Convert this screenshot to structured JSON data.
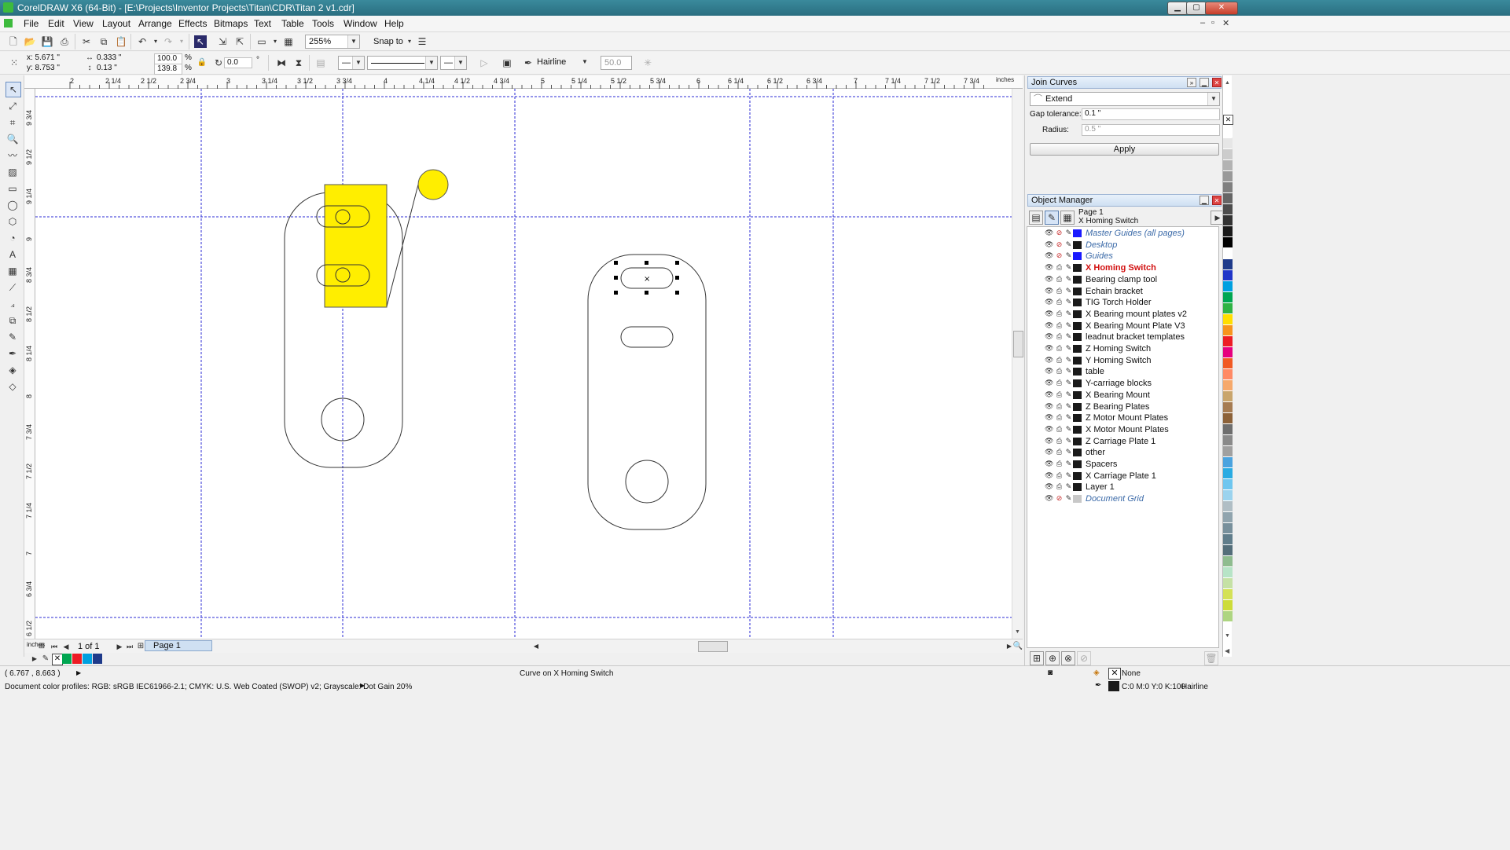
{
  "titlebar": {
    "title": "CorelDRAW X6 (64-Bit) - [E:\\Projects\\Inventor Projects\\Titan\\CDR\\Titan 2 v1.cdr]",
    "minimize": "▁",
    "maximize": "▢",
    "close": "✕"
  },
  "menu": [
    "File",
    "Edit",
    "View",
    "Layout",
    "Arrange",
    "Effects",
    "Bitmaps",
    "Text",
    "Table",
    "Tools",
    "Window",
    "Help"
  ],
  "standard_toolbar": {
    "zoom_level": "255%",
    "snap_to": "Snap to"
  },
  "property_bar": {
    "x": "x: 5.671 \"",
    "y": "y: 8.753 \"",
    "width": "0.333 \"",
    "height": "0.13 \"",
    "scale_x": "100.0",
    "scale_y": "139.8",
    "pct": "%",
    "rotation": "0.0",
    "degree": "°",
    "outline_width": "Hairline",
    "miter": "50.0"
  },
  "ruler": {
    "h_ticks": [
      "2",
      "2 1/4",
      "2 1/2",
      "2 3/4",
      "3",
      "3 1/4",
      "3 1/2",
      "3 3/4",
      "4",
      "4 1/4",
      "4 1/2",
      "4 3/4",
      "5",
      "5 1/4",
      "5 1/2",
      "5 3/4",
      "6",
      "6 1/4",
      "6 1/2",
      "6 3/4",
      "7",
      "7 1/4",
      "7 1/2",
      "7 3/4"
    ],
    "h_units": "inches",
    "v_ticks": [
      "9 3/4",
      "9 1/2",
      "9 1/4",
      "9",
      "8 3/4",
      "8 1/2",
      "8 1/4",
      "8",
      "7 3/4",
      "7 1/2",
      "7 1/4",
      "7",
      "6 3/4",
      "6 1/2"
    ],
    "v_units": "inches"
  },
  "page_nav": {
    "count": "1 of 1",
    "tab": "Page 1"
  },
  "join_curves": {
    "title": "Join Curves",
    "mode": "Extend",
    "gap_label": "Gap tolerance:",
    "gap_value": "0.1 \"",
    "radius_label": "Radius:",
    "radius_value": "0.5 \"",
    "apply": "Apply"
  },
  "object_manager": {
    "title": "Object Manager",
    "page": "Page 1",
    "current_layer": "X Homing Switch",
    "layers": [
      {
        "name": "Master Guides (all pages)",
        "kind": "master",
        "color": "#1a1aff"
      },
      {
        "name": "Desktop",
        "kind": "master",
        "color": "#1a1a1a"
      },
      {
        "name": "Guides",
        "kind": "master",
        "color": "#1a1aff"
      },
      {
        "name": "X Homing Switch",
        "kind": "active",
        "color": "#1a1a1a"
      },
      {
        "name": "Bearing clamp tool",
        "kind": "normal",
        "color": "#1a1a1a"
      },
      {
        "name": "Echain bracket",
        "kind": "normal",
        "color": "#1a1a1a"
      },
      {
        "name": "TIG Torch Holder",
        "kind": "normal",
        "color": "#1a1a1a"
      },
      {
        "name": "X Bearing mount plates v2",
        "kind": "normal",
        "color": "#1a1a1a"
      },
      {
        "name": "X Bearing Mount Plate V3",
        "kind": "normal",
        "color": "#1a1a1a"
      },
      {
        "name": "leadnut bracket templates",
        "kind": "normal",
        "color": "#1a1a1a"
      },
      {
        "name": "Z Homing Switch",
        "kind": "normal",
        "color": "#1a1a1a"
      },
      {
        "name": "Y Homing Switch",
        "kind": "normal",
        "color": "#1a1a1a"
      },
      {
        "name": "table",
        "kind": "normal",
        "color": "#1a1a1a"
      },
      {
        "name": "Y-carriage blocks",
        "kind": "normal",
        "color": "#1a1a1a"
      },
      {
        "name": "X Bearing Mount",
        "kind": "normal",
        "color": "#1a1a1a"
      },
      {
        "name": "Z Bearing Plates",
        "kind": "normal",
        "color": "#1a1a1a"
      },
      {
        "name": "Z Motor Mount Plates",
        "kind": "normal",
        "color": "#1a1a1a"
      },
      {
        "name": "X Motor Mount Plates",
        "kind": "normal",
        "color": "#1a1a1a"
      },
      {
        "name": "Z Carriage Plate 1",
        "kind": "normal",
        "color": "#1a1a1a"
      },
      {
        "name": "other",
        "kind": "normal",
        "color": "#1a1a1a"
      },
      {
        "name": "Spacers",
        "kind": "normal",
        "color": "#1a1a1a"
      },
      {
        "name": "X Carriage Plate 1",
        "kind": "normal",
        "color": "#1a1a1a"
      },
      {
        "name": "Layer 1",
        "kind": "normal",
        "color": "#1a1a1a"
      },
      {
        "name": "Document Grid",
        "kind": "master",
        "color": "#c8c8c8"
      }
    ]
  },
  "status": {
    "coords": "( 6.767 , 8.663 )",
    "message": "Curve on X Homing Switch",
    "profiles": "Document color profiles: RGB: sRGB IEC61966-2.1; CMYK: U.S. Web Coated (SWOP) v2; Grayscale: Dot Gain 20%",
    "fill": "None",
    "outline_color": "C:0 M:0 Y:0 K:100",
    "outline_width": "Hairline"
  },
  "colors": {
    "yellow": "#ffee00",
    "guide": "#2b2bd6",
    "active_layer": "#d21010"
  },
  "palette": [
    "#ffffff",
    "#e6e6e6",
    "#cccccc",
    "#b3b3b3",
    "#999999",
    "#808080",
    "#666666",
    "#4d4d4d",
    "#333333",
    "#1a1a1a",
    "#000000",
    "#ffffff",
    "#1e3a8a",
    "#2036c8",
    "#00a0e0",
    "#00a651",
    "#2fb344",
    "#ffde00",
    "#f7941d",
    "#ed1c24",
    "#e6007e",
    "#f15a24",
    "#ff8a65",
    "#f6a96b",
    "#c9a56c",
    "#a67c52",
    "#8c6239",
    "#6e6e6e",
    "#8a8a8a",
    "#a0a0a0",
    "#4aa3df",
    "#29abe2",
    "#6ec6ef",
    "#9bd3ee",
    "#b0bec5",
    "#90a4ae",
    "#78909c",
    "#607d8b",
    "#546e7a",
    "#8fbc8f",
    "#b7e4c7",
    "#c5e1a5",
    "#d4e157",
    "#cddc39",
    "#aed581"
  ]
}
